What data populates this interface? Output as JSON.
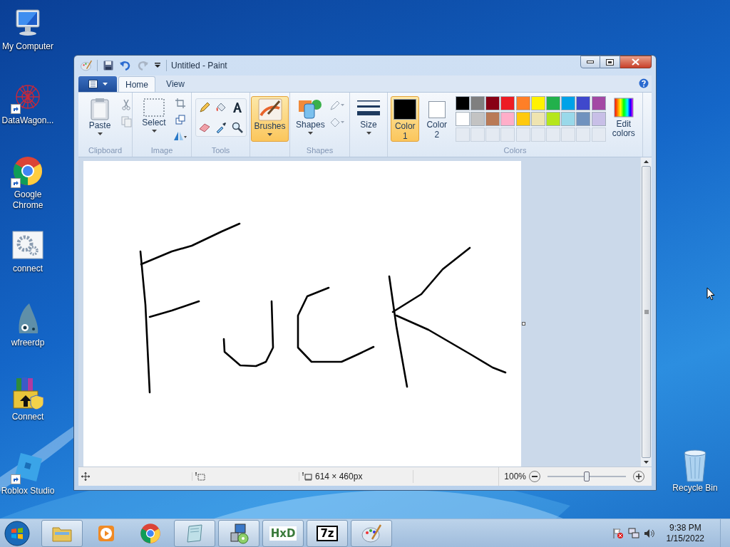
{
  "desktop_icons": [
    {
      "label": "My Computer",
      "kind": "computer",
      "shortcut": false
    },
    {
      "label": "DataWagon...",
      "kind": "network",
      "shortcut": true
    },
    {
      "label": "Google Chrome",
      "kind": "chrome",
      "shortcut": true
    },
    {
      "label": "connect",
      "kind": "gears",
      "shortcut": false
    },
    {
      "label": "wfreerdp",
      "kind": "shark",
      "shortcut": false
    },
    {
      "label": "Connect",
      "kind": "installer",
      "shortcut": false
    },
    {
      "label": "Roblox Studio",
      "kind": "roblox",
      "shortcut": true
    }
  ],
  "recycle_bin": {
    "label": "Recycle Bin"
  },
  "window": {
    "title": "Untitled - Paint",
    "tabs": [
      {
        "label": "Home",
        "selected": true
      },
      {
        "label": "View",
        "selected": false
      }
    ],
    "ribbon": [
      {
        "kind": "clipboard",
        "label": "Clipboard",
        "button": "Paste"
      },
      {
        "kind": "image",
        "label": "Image",
        "button": "Select"
      },
      {
        "kind": "tools",
        "label": "Tools"
      },
      {
        "kind": "brushes",
        "button": "Brushes",
        "selected": true
      },
      {
        "kind": "shapes",
        "label": "Shapes",
        "button": "Shapes",
        "selected": false
      },
      {
        "kind": "size",
        "button": "Size"
      },
      {
        "kind": "colors",
        "label": "Colors",
        "edit_button": "Edit colors",
        "active_colors": [
          {
            "label": "Color 1",
            "color": "#000000",
            "selected": true
          },
          {
            "label": "Color 2",
            "color": "#ffffff",
            "selected": false
          }
        ],
        "palette": [
          {
            "color": "#000000"
          },
          {
            "color": "#7f7f7f"
          },
          {
            "color": "#880015"
          },
          {
            "color": "#ed1c24"
          },
          {
            "color": "#ff7f27"
          },
          {
            "color": "#fff200"
          },
          {
            "color": "#22b14c"
          },
          {
            "color": "#00a2e8"
          },
          {
            "color": "#3f48cc"
          },
          {
            "color": "#a349a4"
          },
          {
            "color": "#ffffff"
          },
          {
            "color": "#c3c3c3"
          },
          {
            "color": "#b97a57"
          },
          {
            "color": "#ffaec9"
          },
          {
            "color": "#ffc90e"
          },
          {
            "color": "#efe4b0"
          },
          {
            "color": "#b5e61d"
          },
          {
            "color": "#99d9ea"
          },
          {
            "color": "#7092be"
          },
          {
            "color": "#c8bfe7"
          }
        ]
      }
    ],
    "status_bar": {
      "dimensions": "614 × 460px",
      "zoom": "100%",
      "zoom_slider": {
        "level": 0.5
      }
    }
  },
  "taskbar": {
    "items": [
      {
        "kind": "explorer",
        "running": true
      },
      {
        "kind": "media",
        "running": false
      },
      {
        "kind": "chrome",
        "running": false
      },
      {
        "kind": "notepad",
        "running": true
      },
      {
        "kind": "network-setup",
        "running": true
      },
      {
        "kind": "hex",
        "running": true,
        "label": "HxD"
      },
      {
        "kind": "archive",
        "running": true,
        "label": "7z"
      },
      {
        "kind": "paint",
        "running": true
      }
    ],
    "clock": {
      "time": "9:38 PM",
      "date": "1/15/2022"
    }
  }
}
